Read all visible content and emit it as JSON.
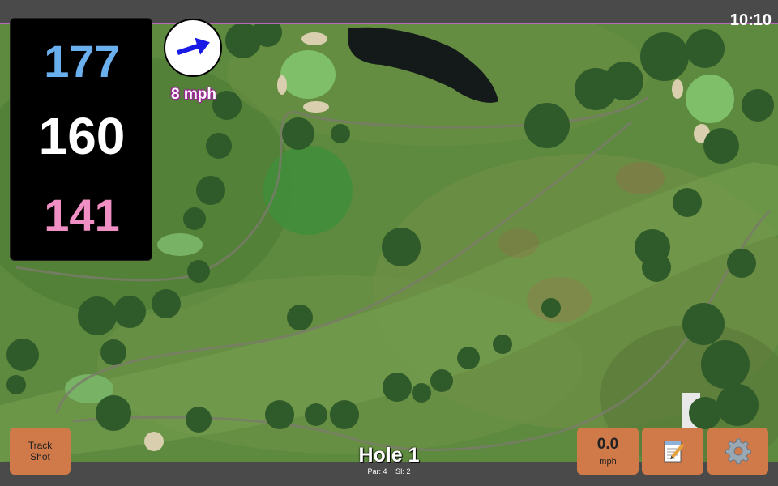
{
  "status_bar": {
    "time": "10:10"
  },
  "distances": {
    "back": "177",
    "middle": "160",
    "front": "141"
  },
  "wind": {
    "speed": "8 mph",
    "icon": "wind-direction-arrow-icon",
    "arrow_color": "#1a1ae6"
  },
  "buttons": {
    "track_shot_line1": "Track",
    "track_shot_line2": "Shot",
    "speed_value": "0.0",
    "speed_unit": "mph",
    "notes_icon": "notepad-icon",
    "settings_icon": "gear-icon"
  },
  "hole": {
    "title": "Hole 1",
    "par": "Par: 4",
    "si": "SI: 2"
  },
  "colors": {
    "button_bg": "#d07a4a",
    "back_distance": "#6bb0ee",
    "front_distance": "#f08fc4",
    "accent_line": "#b56cb8"
  }
}
